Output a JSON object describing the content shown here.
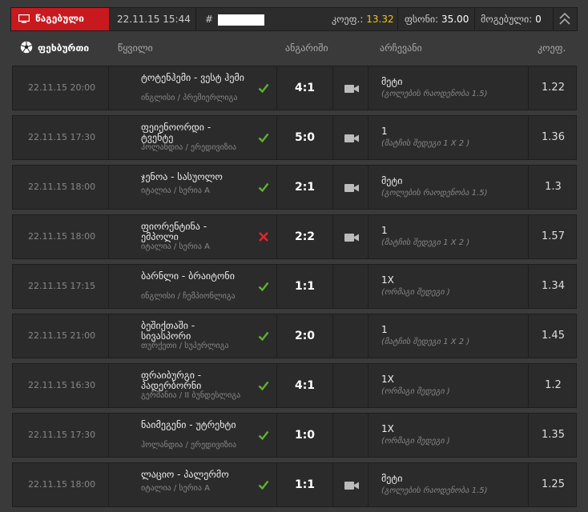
{
  "topbar": {
    "tab_label": "წაგებული",
    "datetime": "22.11.15 15:44",
    "hash": "#",
    "coef_label": "კოეფ.:",
    "coef_value": "13.32",
    "stake_label": "ფსონი:",
    "stake_value": "35.00",
    "win_label": "მოგებული:",
    "win_value": "0"
  },
  "header": {
    "sport": "ფეხბურთი",
    "col_event": "წყვილი",
    "col_score": "ანგარიში",
    "col_pick": "არჩევანი",
    "col_odds": "კოეფ."
  },
  "colors": {
    "accent_red": "#c8191e",
    "win_green": "#5fb12f",
    "loss_red": "#e2262c",
    "highlight_yellow": "#f4c21b"
  },
  "rows": [
    {
      "date": "22.11.15 20:00",
      "team": "ტოტენჰემი - ვესტ ჰემი",
      "league": "ინგლისი / პრემიერლიგა",
      "status": "win",
      "score": "4:1",
      "cam": true,
      "pick": "მეტი",
      "pick_sub": "(გოლების რაოდენობა 1.5)",
      "odds": "1.22"
    },
    {
      "date": "22.11.15 17:30",
      "team": "ფეიენოორდი - ტვენტე",
      "league": "ჰოლანდია / ერედივიზია",
      "status": "win",
      "score": "5:0",
      "cam": true,
      "pick": "1",
      "pick_sub": "(მატჩის შედეგი 1 X 2 )",
      "odds": "1.36"
    },
    {
      "date": "22.11.15 18:00",
      "team": "ჯენოა - სასუოლო",
      "league": "იტალია / სერია A",
      "status": "win",
      "score": "2:1",
      "cam": true,
      "pick": "მეტი",
      "pick_sub": "(გოლების რაოდენობა 1.5)",
      "odds": "1.3"
    },
    {
      "date": "22.11.15 18:00",
      "team": "ფიორენტინა - ემპოლი",
      "league": "იტალია / სერია A",
      "status": "loss",
      "score": "2:2",
      "cam": true,
      "pick": "1",
      "pick_sub": "(მატჩის შედეგი 1 X 2 )",
      "odds": "1.57"
    },
    {
      "date": "22.11.15 17:15",
      "team": "ბარნლი - ბრაიტონი",
      "league": "ინგლისი / ჩემპიონლიგა",
      "status": "win",
      "score": "1:1",
      "cam": false,
      "pick": "1X",
      "pick_sub": "(ორმაგი შედეგი )",
      "odds": "1.34"
    },
    {
      "date": "22.11.15 21:00",
      "team": "ბეშიქთაში - სივასპორი",
      "league": "თურქეთი / სუპერლიგა",
      "status": "win",
      "score": "2:0",
      "cam": false,
      "pick": "1",
      "pick_sub": "(მატჩის შედეგი 1 X 2 )",
      "odds": "1.45"
    },
    {
      "date": "22.11.15 16:30",
      "team": "ფრაიბურგი - პადერბორნი",
      "league": "გერმანია / II ბუნდესლიგა",
      "status": "win",
      "score": "4:1",
      "cam": false,
      "pick": "1X",
      "pick_sub": "(ორმაგი შედეგი )",
      "odds": "1.2"
    },
    {
      "date": "22.11.15 17:30",
      "team": "ნაიმეგენი - უტრეხტი",
      "league": "ჰოლანდია / ერედივიზია",
      "status": "win",
      "score": "1:0",
      "cam": false,
      "pick": "1X",
      "pick_sub": "(ორმაგი შედეგი )",
      "odds": "1.35"
    },
    {
      "date": "22.11.15 18:00",
      "team": "ლაციო - პალერმო",
      "league": "იტალია / სერია A",
      "status": "win",
      "score": "1:1",
      "cam": true,
      "pick": "მეტი",
      "pick_sub": "(გოლების რაოდენობა 1.5)",
      "odds": "1.25"
    }
  ]
}
